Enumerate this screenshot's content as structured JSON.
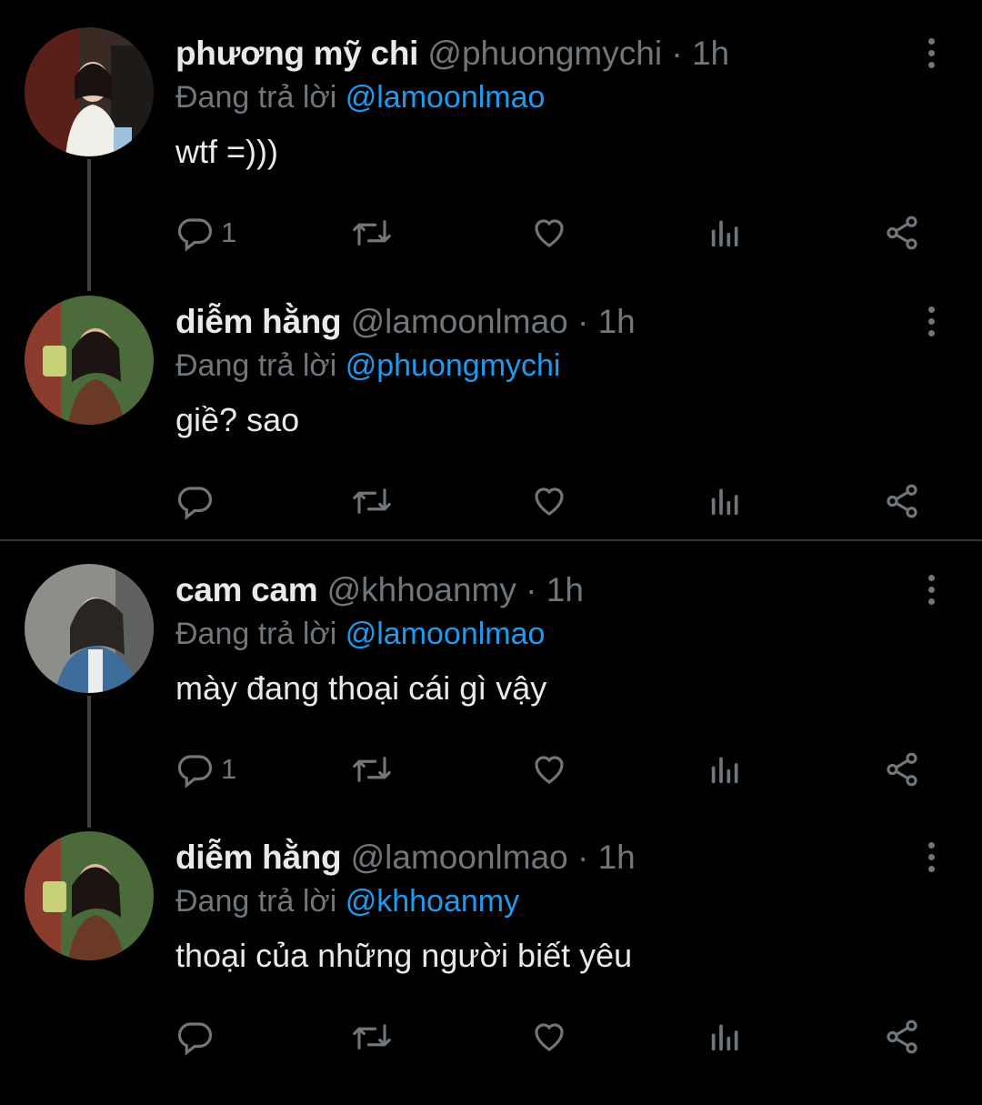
{
  "tweets": [
    {
      "name": "phương mỹ chi",
      "handle": "@phuongmychi",
      "separator": "·",
      "time": "1h",
      "reply_prefix": "Đang trả lời",
      "reply_to": "@lamoonlmao",
      "text": "wtf =)))",
      "reply_count": "1"
    },
    {
      "name": "diễm hằng",
      "handle": "@lamoonlmao",
      "separator": "·",
      "time": "1h",
      "reply_prefix": "Đang trả lời",
      "reply_to": "@phuongmychi",
      "text": "giề? sao",
      "reply_count": ""
    },
    {
      "name": "cam cam",
      "handle": "@khhoanmy",
      "separator": "·",
      "time": "1h",
      "reply_prefix": "Đang trả lời",
      "reply_to": "@lamoonlmao",
      "text": "mày đang thoại cái gì vậy",
      "reply_count": "1"
    },
    {
      "name": "diễm hằng",
      "handle": "@lamoonlmao",
      "separator": "·",
      "time": "1h",
      "reply_prefix": "Đang trả lời",
      "reply_to": "@khhoanmy",
      "text": "thoại của những người biết yêu",
      "reply_count": ""
    }
  ],
  "icons": {
    "reply": "reply-icon",
    "retweet": "retweet-icon",
    "like": "heart-icon",
    "views": "views-icon",
    "share": "share-icon",
    "more": "more-icon"
  },
  "colors": {
    "background": "#000000",
    "text": "#e7e9ea",
    "muted": "#71767b",
    "link": "#1d9bf0",
    "divider": "#2f3336"
  }
}
